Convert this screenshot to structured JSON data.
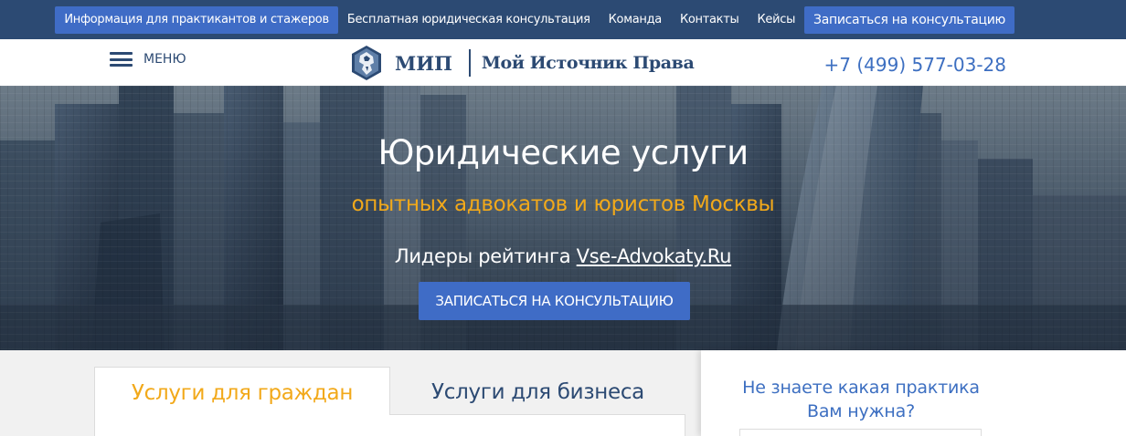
{
  "topnav": {
    "items": [
      "Информация для практикантов и стажеров",
      "Бесплатная юридическая консультация",
      "Команда",
      "Контакты",
      "Кейсы"
    ],
    "cta": "Записаться на консультацию"
  },
  "header": {
    "menu_label": "МЕНЮ",
    "logo_abbr": "МИП",
    "logo_name": "Мой Источник Права",
    "phone": "+7 (499) 577-03-28"
  },
  "hero": {
    "title": "Юридические услуги",
    "subtitle": "опытных адвокатов и юристов Москвы",
    "rating_prefix": "Лидеры рейтинга ",
    "rating_link": "Vse-Advokaty.Ru",
    "button": "ЗАПИСАТЬСЯ НА КОНСУЛЬТАЦИЮ"
  },
  "tabs": {
    "citizens": "Услуги для граждан",
    "business": "Услуги для бизнеса"
  },
  "side": {
    "question_line1": "Не знаете какая практика",
    "question_line2": "Вам нужна?"
  },
  "colors": {
    "navy": "#2c4a73",
    "accent_blue": "#3f6cc6",
    "orange": "#f2a91a"
  },
  "icons": [
    "menu-icon",
    "lion-shield-logo-icon"
  ]
}
